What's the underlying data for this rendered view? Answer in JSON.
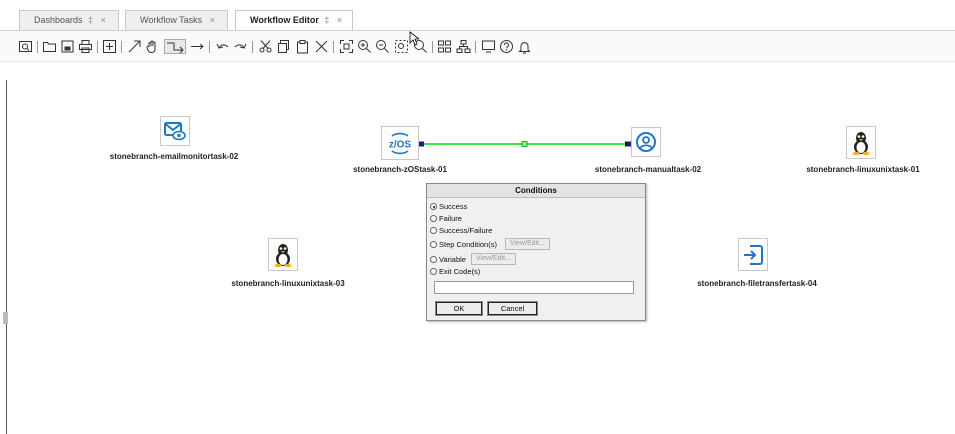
{
  "tabs": [
    {
      "label": "Dashboards",
      "pin": "‡",
      "close": "×"
    },
    {
      "label": "Workflow Tasks",
      "pin": "",
      "close": "×"
    },
    {
      "label": "Workflow Editor",
      "pin": "‡",
      "close": "×"
    }
  ],
  "toolbar": {
    "icons": [
      "view-icon",
      "open-folder-icon",
      "save-icon",
      "print-icon",
      "expand-icon",
      "arrow-icon",
      "hand-pan-icon",
      "connector-icon",
      "straight-connector-icon",
      "undo-icon",
      "redo-icon",
      "cut-icon",
      "copy-icon",
      "paste-icon",
      "delete-icon",
      "fit-icon",
      "zoom-in-icon",
      "zoom-out-icon",
      "zoom-region-icon",
      "search-icon",
      "layout-icon",
      "tree-layout-icon",
      "monitor-icon",
      "help-icon",
      "notification-icon"
    ]
  },
  "nodes": {
    "emailmonitor": {
      "label": "stonebranch-emailmonitortask-02",
      "icon": "email-monitor-icon"
    },
    "zos": {
      "label": "stonebranch-zOStask-01",
      "icon": "zos-icon",
      "icon_text": "z/OS"
    },
    "manual": {
      "label": "stonebranch-manualtask-02",
      "icon": "manual-user-icon"
    },
    "linux01": {
      "label": "stonebranch-linuxunixtask-01",
      "icon": "linux-tux-icon"
    },
    "linux03": {
      "label": "stonebranch-linuxunixtask-03",
      "icon": "linux-tux-icon"
    },
    "filetransfer": {
      "label": "stonebranch-filetransfertask-04",
      "icon": "file-transfer-icon"
    }
  },
  "connector": {
    "color": "#00e000"
  },
  "dialog": {
    "title": "Conditions",
    "options": {
      "success": "Success",
      "failure": "Failure",
      "success_failure": "Success/Failure",
      "step_condition": "Step Condition(s)",
      "variable": "Variable",
      "exit_code": "Exit Code(s)"
    },
    "selected": "Success",
    "view_edit": "View/Edit...",
    "ok": "OK",
    "cancel": "Cancel"
  },
  "colors": {
    "accent": "#1e78c8",
    "connector": "#00e000",
    "port": "#1a1aa0"
  }
}
